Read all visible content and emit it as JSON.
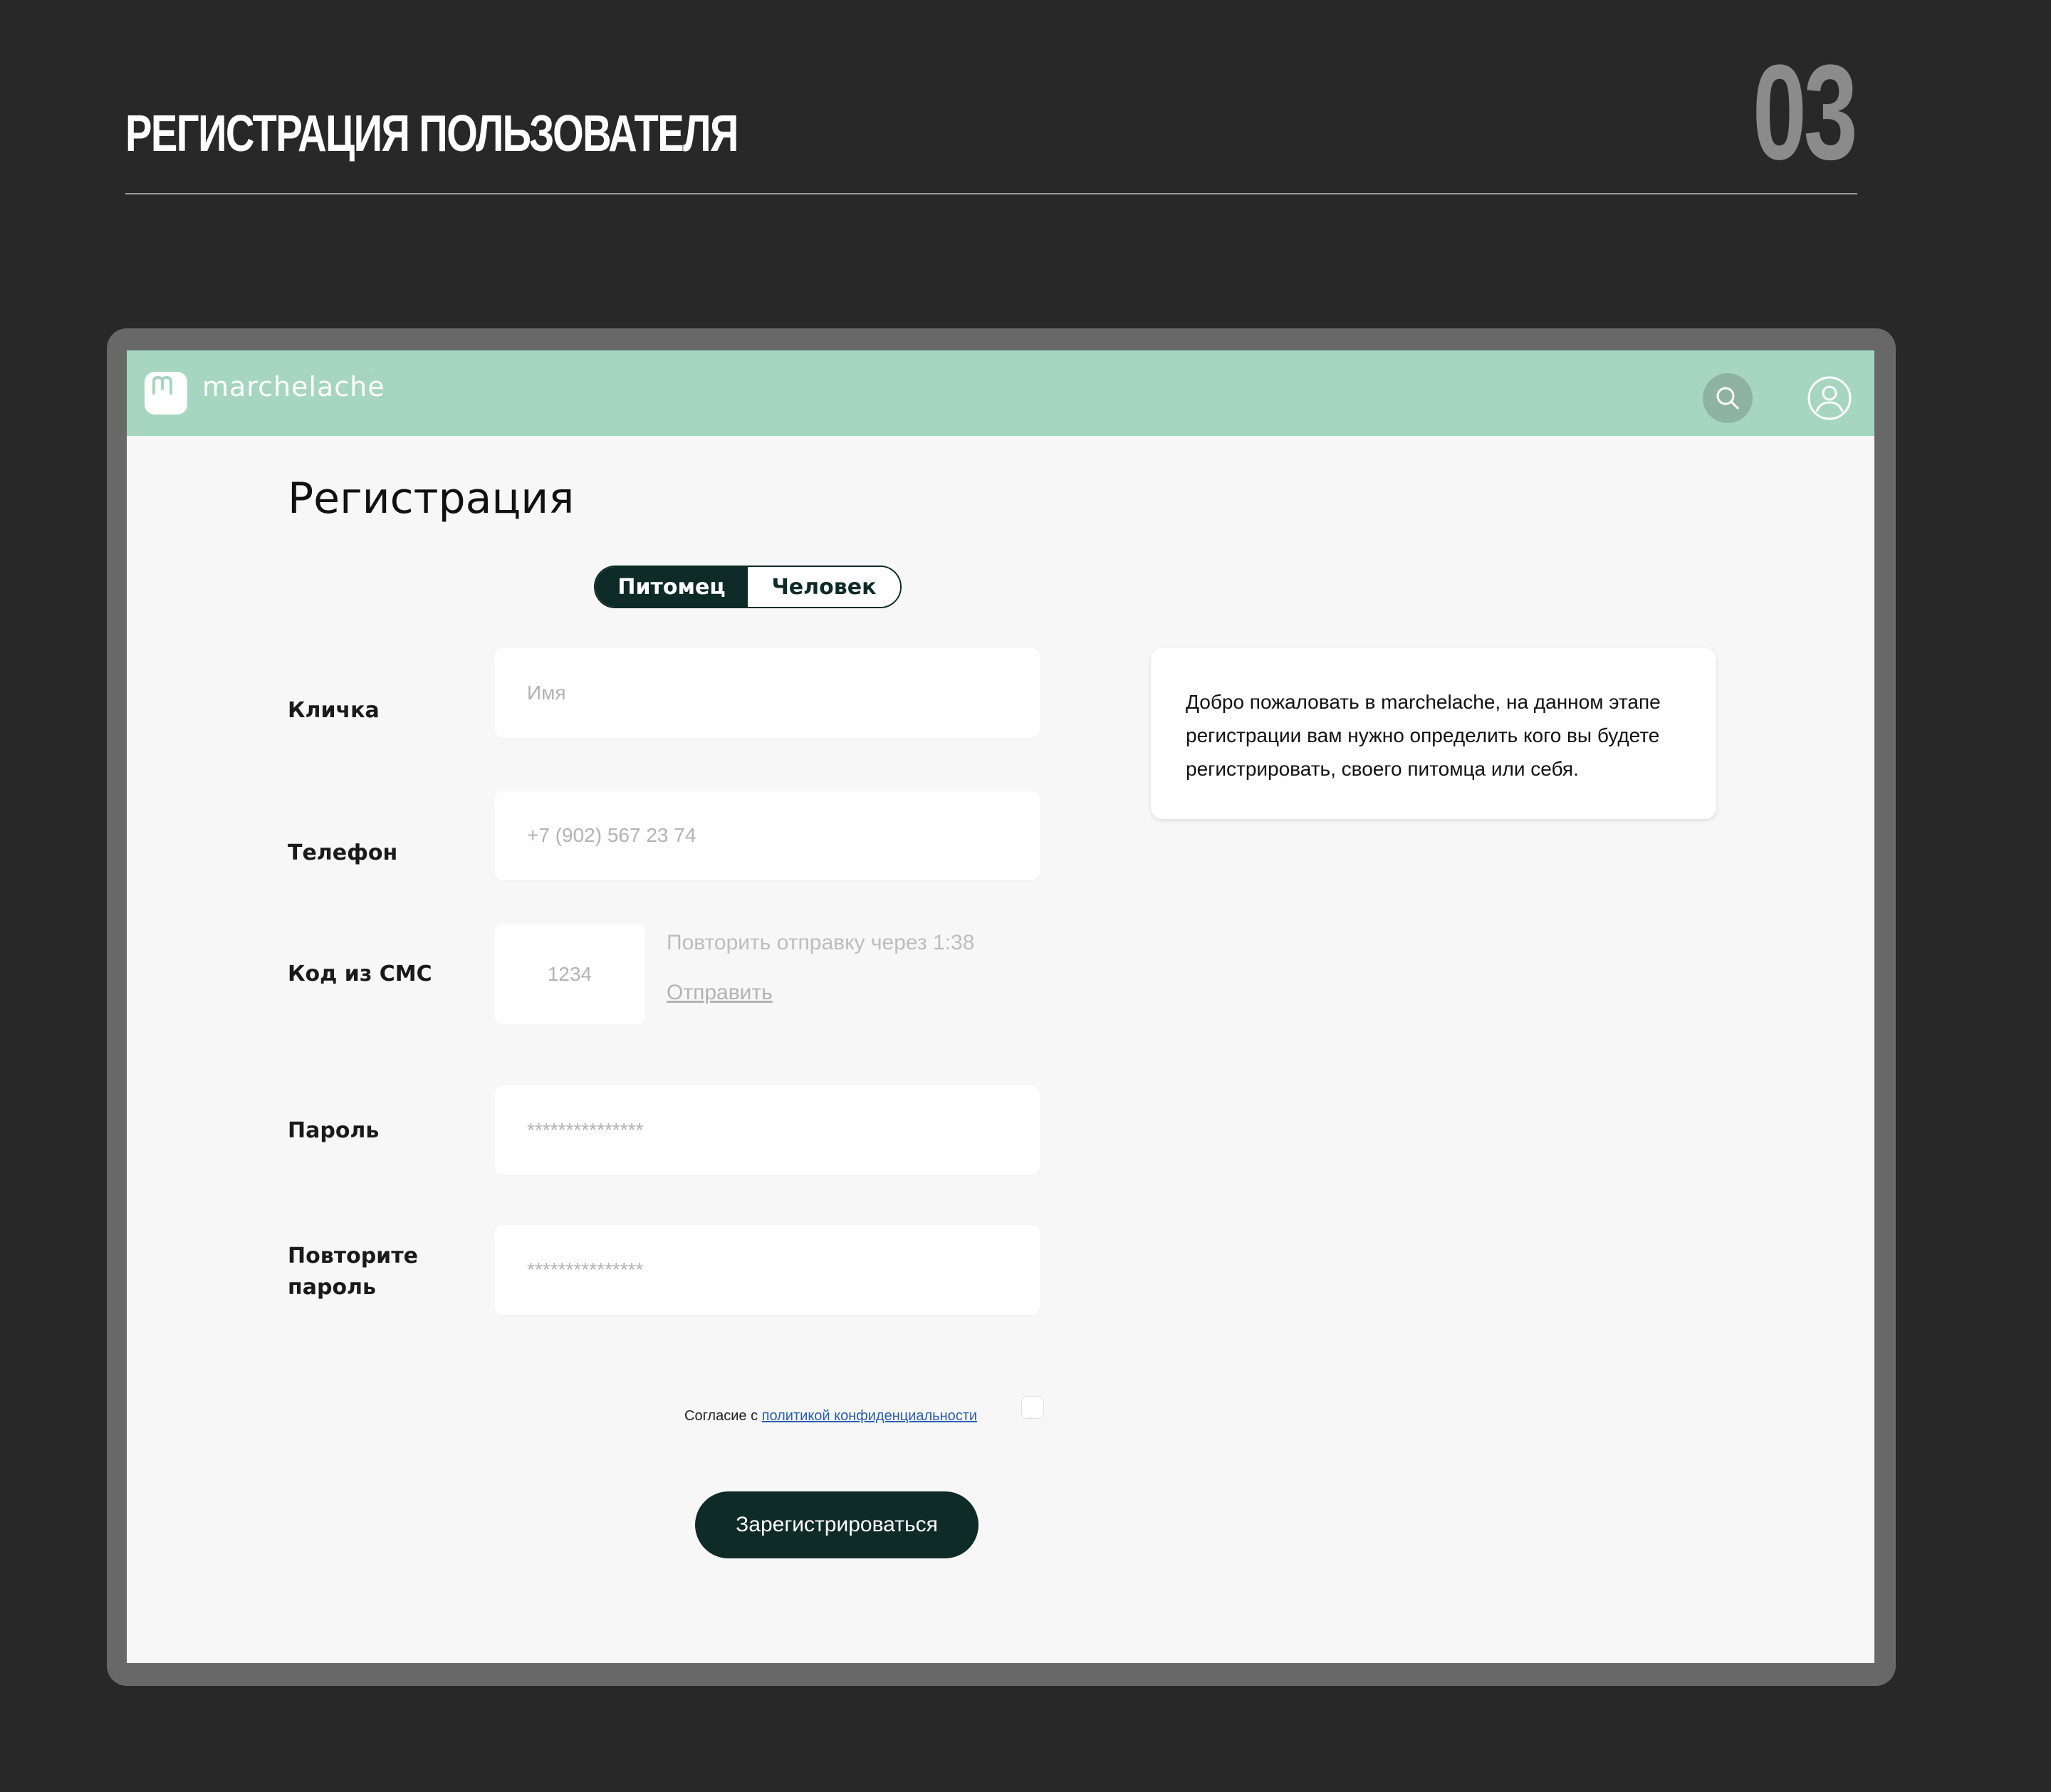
{
  "slide": {
    "title": "РЕГИСТРАЦИЯ ПОЛЬЗОВАТЕЛЯ",
    "number": "03"
  },
  "header": {
    "brand": "marchelache",
    "brand_color": "#a6d5c0",
    "icons": [
      "search-icon",
      "user-icon"
    ]
  },
  "page": {
    "heading": "Регистрация"
  },
  "type_switch": {
    "options": [
      {
        "label": "Питомец",
        "active": true
      },
      {
        "label": "Человек",
        "active": false
      }
    ],
    "active_color": "#0f2b27"
  },
  "form": {
    "nickname_label": "Кличка",
    "nickname_placeholder": "Имя",
    "phone_label": "Телефон",
    "phone_placeholder": "+7 (902) 567 23 74",
    "sms_label": "Код из СМС",
    "sms_placeholder": "1234",
    "resend_timer": "Повторить отправку через 1:38",
    "resend_link": "Отправить",
    "password_label": "Пароль",
    "password_placeholder": "***************",
    "repeat_label_line1": "Повторите",
    "repeat_label_line2": "пароль",
    "repeat_placeholder": "***************"
  },
  "info_card": {
    "text": "Добро пожаловать в marchelache, на данном этапе регистрации вам нужно определить кого вы будете регистрировать, своего питомца или себя."
  },
  "consent": {
    "prefix": "Согласие с ",
    "link": "политикой конфиденциальности",
    "checked": false
  },
  "submit": {
    "label": "Зарегистрироваться"
  }
}
